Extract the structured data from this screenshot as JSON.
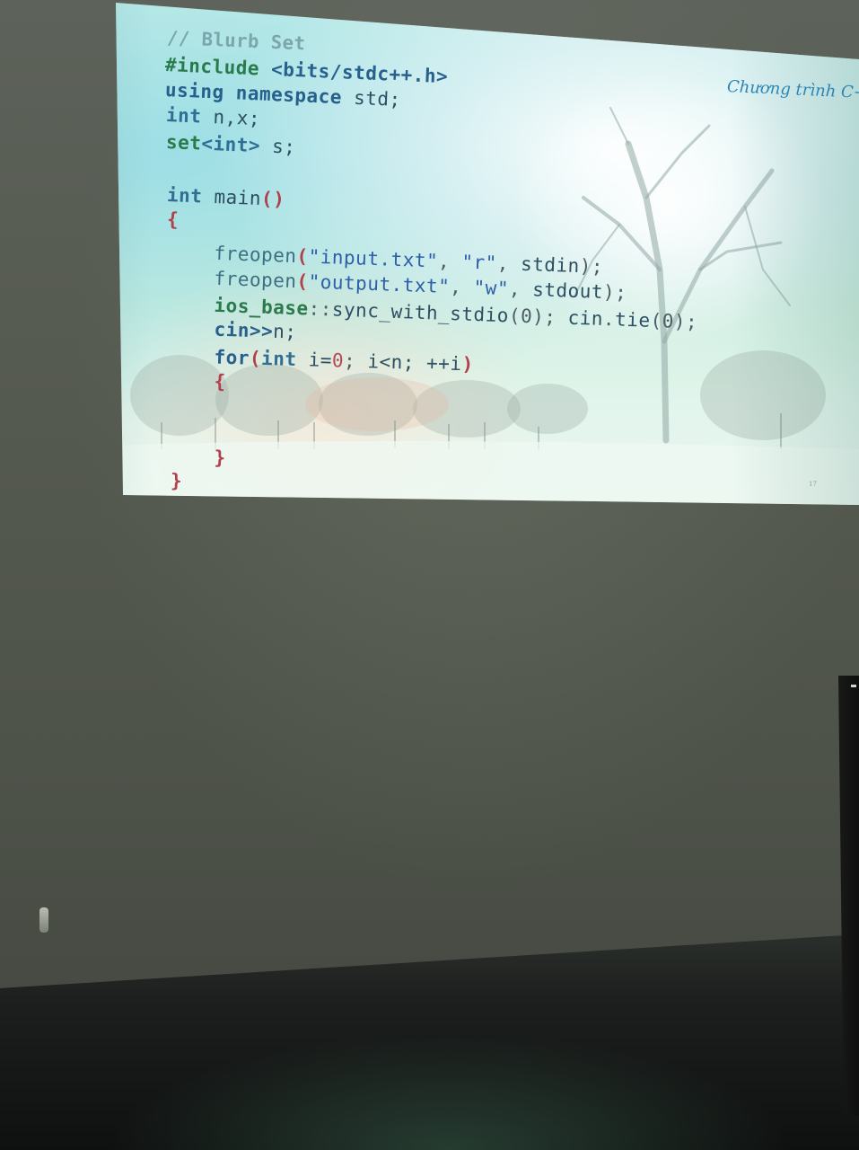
{
  "slide": {
    "header_title": "Chương trình C++",
    "page_number": "17",
    "code_lines": [
      [
        {
          "t": "// Blurb Set",
          "c": "cm"
        }
      ],
      [
        {
          "t": "#include ",
          "c": "dir"
        },
        {
          "t": "<bits/stdc++.h>",
          "c": "kw"
        }
      ],
      [
        {
          "t": "using ",
          "c": "kw"
        },
        {
          "t": "namespace ",
          "c": "kw"
        },
        {
          "t": "std;",
          "c": "id"
        }
      ],
      [
        {
          "t": "int ",
          "c": "type"
        },
        {
          "t": "n,x;",
          "c": "id"
        }
      ],
      [
        {
          "t": "set",
          "c": "dir"
        },
        {
          "t": "<int>",
          "c": "type"
        },
        {
          "t": " s;",
          "c": "id"
        }
      ],
      [],
      [
        {
          "t": "int ",
          "c": "type"
        },
        {
          "t": "main",
          "c": "id"
        },
        {
          "t": "()",
          "c": "br"
        }
      ],
      [
        {
          "t": "{",
          "c": "br"
        }
      ],
      [
        {
          "t": "    freopen",
          "c": "fn"
        },
        {
          "t": "(",
          "c": "br"
        },
        {
          "t": "\"input.txt\"",
          "c": "str"
        },
        {
          "t": ", ",
          "c": "pu"
        },
        {
          "t": "\"r\"",
          "c": "str"
        },
        {
          "t": ", ",
          "c": "pu"
        },
        {
          "t": "stdin",
          "c": "id"
        },
        {
          "t": ");",
          "c": "pu"
        }
      ],
      [
        {
          "t": "    freopen",
          "c": "fn"
        },
        {
          "t": "(",
          "c": "br"
        },
        {
          "t": "\"output.txt\"",
          "c": "str"
        },
        {
          "t": ", ",
          "c": "pu"
        },
        {
          "t": "\"w\"",
          "c": "str"
        },
        {
          "t": ", ",
          "c": "pu"
        },
        {
          "t": "stdout",
          "c": "id"
        },
        {
          "t": ");",
          "c": "pu"
        }
      ],
      [
        {
          "t": "    ios_base",
          "c": "dir"
        },
        {
          "t": "::",
          "c": "pu"
        },
        {
          "t": "sync_with_stdio",
          "c": "id"
        },
        {
          "t": "(0); ",
          "c": "pu"
        },
        {
          "t": "cin",
          "c": "id"
        },
        {
          "t": ".",
          "c": "pu"
        },
        {
          "t": "tie",
          "c": "id"
        },
        {
          "t": "(0);",
          "c": "pu"
        }
      ],
      [
        {
          "t": "    cin",
          "c": "kw"
        },
        {
          "t": ">>",
          "c": "kw"
        },
        {
          "t": "n;",
          "c": "id"
        }
      ],
      [
        {
          "t": "    for",
          "c": "kw"
        },
        {
          "t": "(",
          "c": "br"
        },
        {
          "t": "int ",
          "c": "type"
        },
        {
          "t": "i=",
          "c": "id"
        },
        {
          "t": "0",
          "c": "num"
        },
        {
          "t": "; ",
          "c": "pu"
        },
        {
          "t": "i<n; ",
          "c": "id"
        },
        {
          "t": "++i",
          "c": "id"
        },
        {
          "t": ")",
          "c": "br"
        }
      ],
      [
        {
          "t": "    {",
          "c": "br"
        }
      ],
      [],
      [],
      [
        {
          "t": "    }",
          "c": "br"
        }
      ],
      [
        {
          "t": "}",
          "c": "br"
        }
      ]
    ]
  }
}
